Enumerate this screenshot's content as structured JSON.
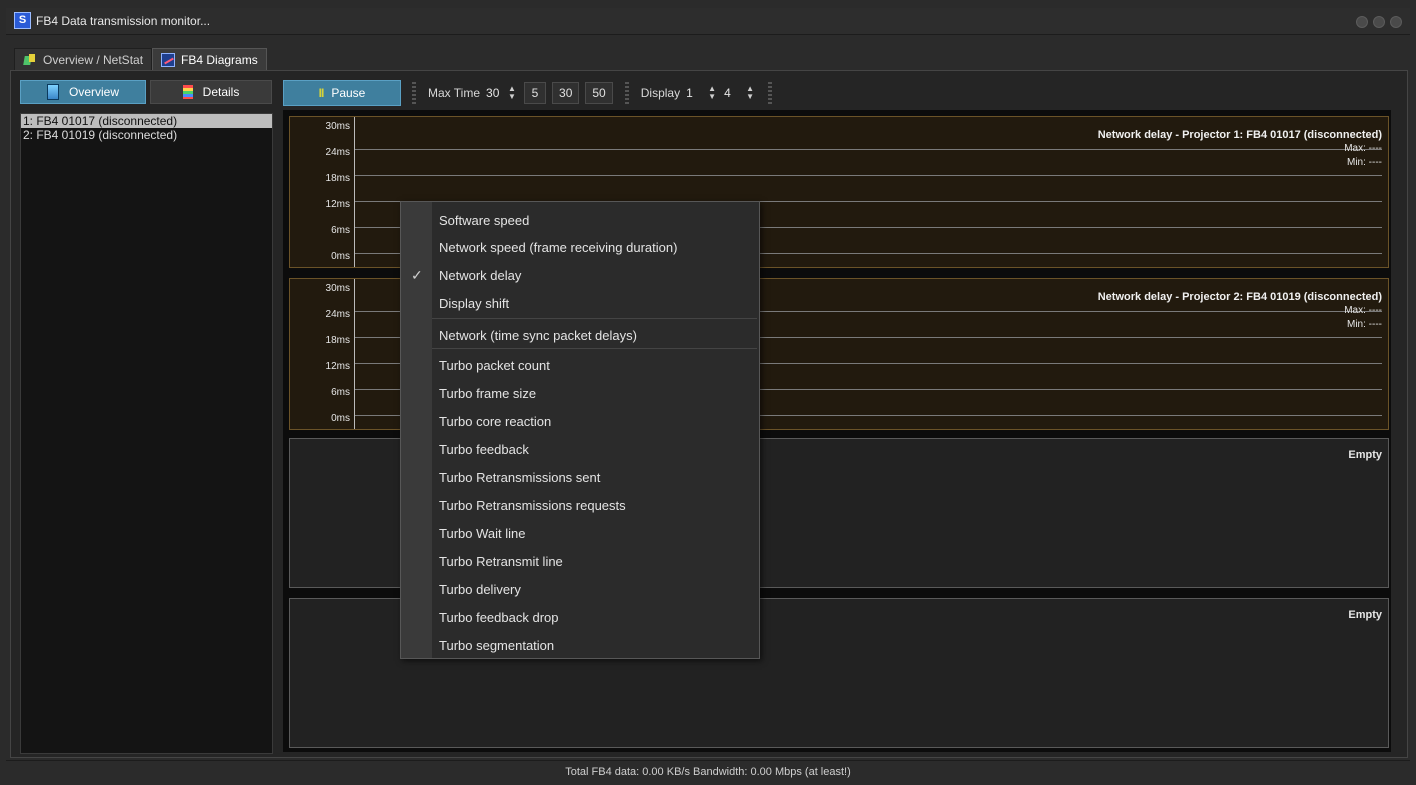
{
  "window": {
    "title": "FB4 Data transmission monitor..."
  },
  "tabs": [
    {
      "label": "Overview / NetStat",
      "icon": "overview-icon"
    },
    {
      "label": "FB4 Diagrams",
      "icon": "diagram-icon",
      "active": true
    }
  ],
  "left_panel": {
    "overview_label": "Overview",
    "details_label": "Details",
    "projectors": [
      {
        "label": "1: FB4 01017 (disconnected)",
        "selected": true
      },
      {
        "label": "2: FB4 01019 (disconnected)",
        "selected": false
      }
    ]
  },
  "toolbar": {
    "pause_label": "Pause",
    "max_time_label": "Max Time",
    "max_time_value": "30",
    "presets": [
      "5",
      "30",
      "50"
    ],
    "display_label": "Display",
    "display_from": "1",
    "display_to": "4"
  },
  "panels": [
    {
      "title": "Network delay - Projector 1: FB4 01017 (disconnected)",
      "max": "Max: ----",
      "min": "Min: ----",
      "yticks": [
        "30ms",
        "24ms",
        "18ms",
        "12ms",
        "6ms",
        "0ms"
      ]
    },
    {
      "title": "Network delay - Projector 2: FB4 01019 (disconnected)",
      "max": "Max: ----",
      "min": "Min: ----",
      "yticks": [
        "30ms",
        "24ms",
        "18ms",
        "12ms",
        "6ms",
        "0ms"
      ]
    },
    {
      "empty": "Empty"
    },
    {
      "empty": "Empty"
    }
  ],
  "context_menu": {
    "items": [
      "Software speed",
      "Network speed (frame receiving duration)",
      "Network delay",
      "Display shift",
      "Network (time sync packet delays)",
      "Turbo packet count",
      "Turbo frame size",
      "Turbo core reaction",
      "Turbo feedback",
      "Turbo Retransmissions sent",
      "Turbo Retransmissions requests",
      "Turbo Wait line",
      "Turbo Retransmit line",
      "Turbo delivery",
      "Turbo feedback drop",
      "Turbo segmentation"
    ],
    "checked": "Network delay",
    "check_glyph": "✓"
  },
  "status": {
    "text": "Total FB4 data: 0.00 KB/s   Bandwidth: 0.00 Mbps (at least!)"
  }
}
